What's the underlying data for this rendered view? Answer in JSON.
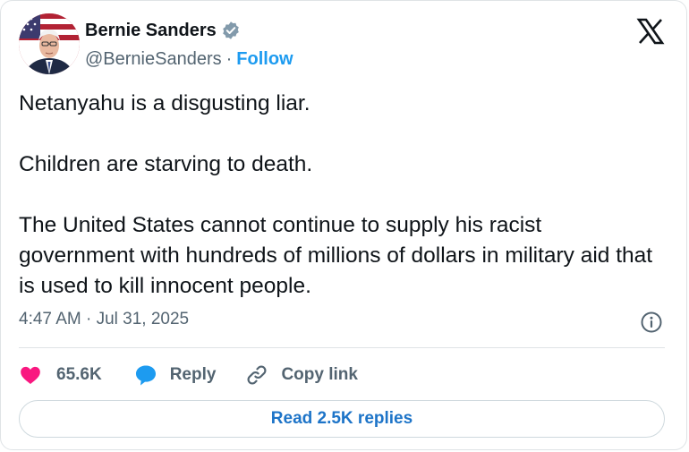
{
  "author": {
    "display_name": "Bernie Sanders",
    "handle": "@BernieSanders",
    "separator": "·",
    "follow_label": "Follow",
    "verified": true
  },
  "tweet": {
    "paragraphs": [
      "Netanyahu is a disgusting liar.",
      "Children are starving to death.",
      "The United States cannot continue to supply his racist government with hundreds of millions of dollars in military aid that is used to kill innocent people."
    ],
    "timestamp": "4:47 AM · Jul 31, 2025"
  },
  "actions": {
    "likes": "65.6K",
    "reply_label": "Reply",
    "copy_link_label": "Copy link"
  },
  "read_replies_label": "Read 2.5K replies",
  "colors": {
    "accent": "#1d9bf0",
    "like": "#f91880",
    "text": "#0f1419",
    "secondary": "#536471"
  },
  "icons": [
    "verified-badge-icon",
    "x-logo-icon",
    "info-icon",
    "heart-icon",
    "reply-bubble-icon",
    "link-icon"
  ]
}
